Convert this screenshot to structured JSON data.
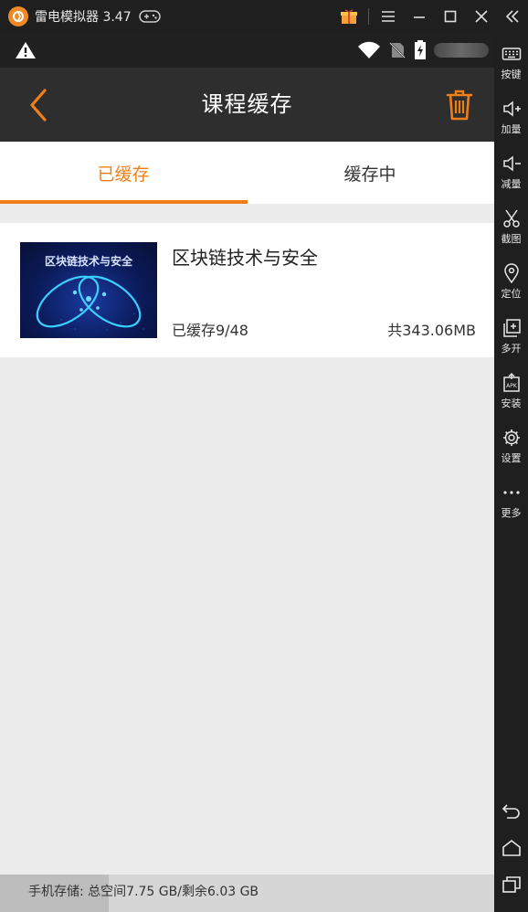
{
  "emulator": {
    "title": "雷电模拟器 3.47",
    "sidebar": [
      {
        "label": "按键",
        "icon": "keyboard-icon"
      },
      {
        "label": "加量",
        "icon": "volume-up-icon"
      },
      {
        "label": "减量",
        "icon": "volume-down-icon"
      },
      {
        "label": "截图",
        "icon": "scissors-icon"
      },
      {
        "label": "定位",
        "icon": "location-icon"
      },
      {
        "label": "多开",
        "icon": "multi-window-icon"
      },
      {
        "label": "安装",
        "icon": "apk-install-icon"
      },
      {
        "label": "设置",
        "icon": "gear-icon"
      },
      {
        "label": "更多",
        "icon": "more-dots-icon"
      }
    ]
  },
  "app": {
    "title": "课程缓存",
    "tabs": [
      {
        "label": "已缓存",
        "active": true
      },
      {
        "label": "缓存中",
        "active": false
      }
    ],
    "courses": [
      {
        "title": "区块链技术与安全",
        "thumbnail_text": "区块链技术与安全",
        "progress": "已缓存9/48",
        "size": "共343.06MB"
      }
    ],
    "storage": {
      "text": "手机存储: 总空间7.75 GB/剩余6.03 GB",
      "used_fraction": 0.22
    },
    "accent_color": "#f07f18"
  }
}
